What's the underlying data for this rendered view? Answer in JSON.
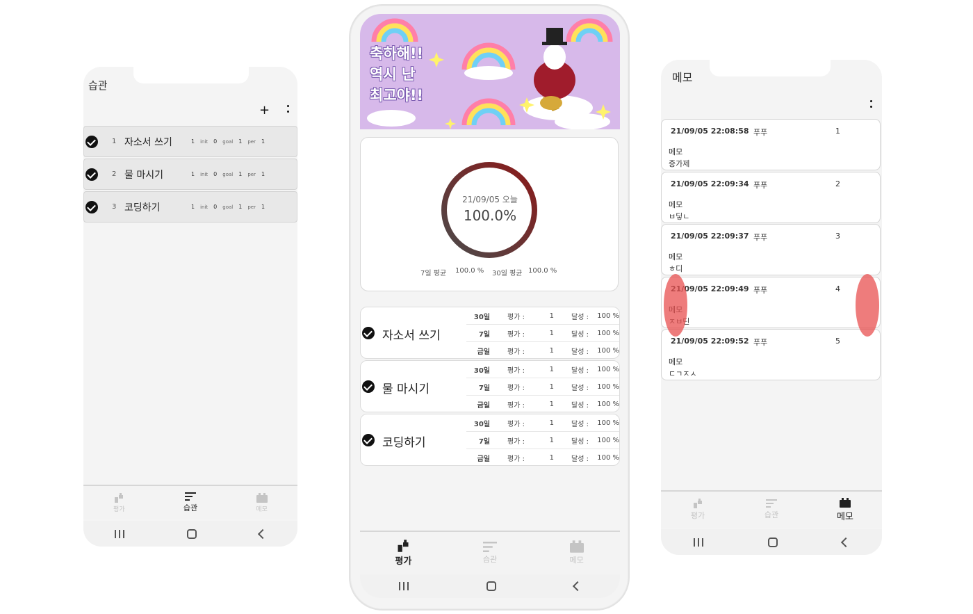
{
  "left": {
    "title": "습관",
    "add_icon": "plus",
    "more_icon": "vertical-dots",
    "rows": [
      {
        "index": "1",
        "name": "자소서 쓰기",
        "count": "1",
        "init_label": "init",
        "init": "0",
        "goal_label": "goal",
        "goal": "1",
        "per_label": "per",
        "per": "1"
      },
      {
        "index": "2",
        "name": "물 마시기",
        "count": "1",
        "init_label": "init",
        "init": "0",
        "goal_label": "goal",
        "goal": "1",
        "per_label": "per",
        "per": "1"
      },
      {
        "index": "3",
        "name": "코딩하기",
        "count": "1",
        "init_label": "init",
        "init": "0",
        "goal_label": "goal",
        "goal": "1",
        "per_label": "per",
        "per": "1"
      }
    ],
    "nav": [
      {
        "label": "평가",
        "icon": "evaluate-icon"
      },
      {
        "label": "습관",
        "icon": "habit-icon"
      },
      {
        "label": "메모",
        "icon": "memo-icon"
      }
    ],
    "active_nav": "습관"
  },
  "center": {
    "banner": {
      "line1": "축하해!!",
      "line2": "역시 난",
      "line3": "최고야!!",
      "bg": "#d7b9ea"
    },
    "stats": {
      "date_label": "21/09/05 오늘",
      "percent_label": "100.0%",
      "progress": 1.0,
      "week_label": "7일 평균",
      "week_value": "100.0 %",
      "month_label": "30일 평균",
      "month_value": "100.0 %"
    },
    "goals": [
      {
        "name": "자소서 쓰기",
        "lines": [
          {
            "period": "30일",
            "eval_label": "평가 :",
            "eval": "1",
            "ach_label": "달성 :",
            "ach": "100 %"
          },
          {
            "period": "7일",
            "eval_label": "평가 :",
            "eval": "1",
            "ach_label": "달성 :",
            "ach": "100 %"
          },
          {
            "period": "금일",
            "eval_label": "평가 :",
            "eval": "1",
            "ach_label": "달성 :",
            "ach": "100 %"
          }
        ]
      },
      {
        "name": "물 마시기",
        "lines": [
          {
            "period": "30일",
            "eval_label": "평가 :",
            "eval": "1",
            "ach_label": "달성 :",
            "ach": "100 %"
          },
          {
            "period": "7일",
            "eval_label": "평가 :",
            "eval": "1",
            "ach_label": "달성 :",
            "ach": "100 %"
          },
          {
            "period": "금일",
            "eval_label": "평가 :",
            "eval": "1",
            "ach_label": "달성 :",
            "ach": "100 %"
          }
        ]
      },
      {
        "name": "코딩하기",
        "lines": [
          {
            "period": "30일",
            "eval_label": "평가 :",
            "eval": "1",
            "ach_label": "달성 :",
            "ach": "100 %"
          },
          {
            "period": "7일",
            "eval_label": "평가 :",
            "eval": "1",
            "ach_label": "달성 :",
            "ach": "100 %"
          },
          {
            "period": "금일",
            "eval_label": "평가 :",
            "eval": "1",
            "ach_label": "달성 :",
            "ach": "100 %"
          }
        ]
      }
    ],
    "nav": [
      {
        "label": "평가",
        "icon": "evaluate-icon"
      },
      {
        "label": "습관",
        "icon": "habit-icon"
      },
      {
        "label": "메모",
        "icon": "memo-icon"
      }
    ],
    "active_nav": "평가",
    "ring_color_start": "#8b1a1a",
    "ring_color_end": "#4a4a4a"
  },
  "right": {
    "title": "메모",
    "more_icon": "vertical-dots",
    "memos": [
      {
        "date": "21/09/05 22:08:58",
        "user": "푸푸",
        "num": "1",
        "label": "메모",
        "text": "증가제"
      },
      {
        "date": "21/09/05 22:09:34",
        "user": "푸푸",
        "num": "2",
        "label": "메모",
        "text": "ㅂ딯ㄴ"
      },
      {
        "date": "21/09/05 22:09:37",
        "user": "푸푸",
        "num": "3",
        "label": "메모",
        "text": "ㅎ디"
      },
      {
        "date": "21/09/05 22:09:49",
        "user": "푸푸",
        "num": "4",
        "label": "메모",
        "text": "ㅈㅂ딘"
      },
      {
        "date": "21/09/05 22:09:52",
        "user": "푸푸",
        "num": "5",
        "label": "메모",
        "text": "ㄷㄱㅈㅅ"
      }
    ],
    "nav": [
      {
        "label": "평가",
        "icon": "evaluate-icon"
      },
      {
        "label": "습관",
        "icon": "habit-icon"
      },
      {
        "label": "메모",
        "icon": "memo-icon"
      }
    ],
    "active_nav": "메모",
    "swipe_color": "#e85050"
  }
}
